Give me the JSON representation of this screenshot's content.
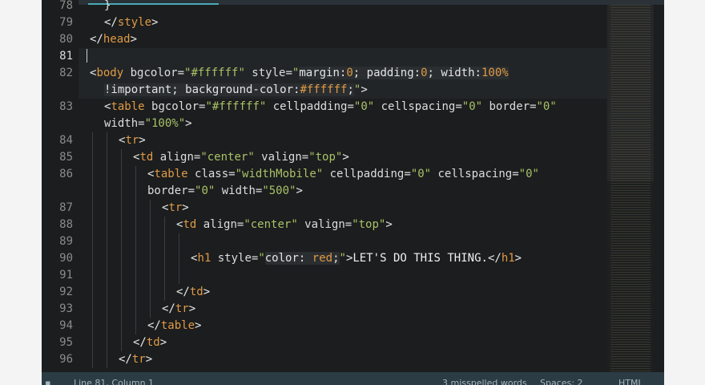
{
  "editor": {
    "lines": [
      {
        "n": "78",
        "segments": [
          {
            "c": "pl",
            "t": "}"
          }
        ]
      },
      {
        "n": "79",
        "segments": [
          {
            "c": "tk",
            "t": "</"
          },
          {
            "c": "tag",
            "t": "style"
          },
          {
            "c": "tk",
            "t": ">"
          }
        ]
      },
      {
        "n": "80",
        "segments": [
          {
            "c": "tk",
            "t": "</"
          },
          {
            "c": "tag",
            "t": "head"
          },
          {
            "c": "tk",
            "t": ">"
          }
        ]
      },
      {
        "n": "81",
        "segments": []
      },
      {
        "n": "82",
        "segments": [
          {
            "c": "tk",
            "t": "<"
          },
          {
            "c": "tag",
            "t": "body"
          },
          {
            "c": "attr",
            "t": " bgcolor="
          },
          {
            "c": "str",
            "t": "\"#ffffff\""
          },
          {
            "c": "attr",
            "t": " style="
          },
          {
            "c": "str",
            "t": "\""
          },
          {
            "c": "pl inl",
            "t": "margin"
          },
          {
            "c": "tk inl",
            "t": ":"
          },
          {
            "c": "num inl",
            "t": "0"
          },
          {
            "c": "pl inl",
            "t": "; padding"
          },
          {
            "c": "tk inl",
            "t": ":"
          },
          {
            "c": "num inl",
            "t": "0"
          },
          {
            "c": "pl inl",
            "t": "; width"
          },
          {
            "c": "tk inl",
            "t": ":"
          },
          {
            "c": "num inl",
            "t": "100%"
          }
        ]
      },
      {
        "n": "",
        "segments": [
          {
            "c": "pl inl",
            "t": "!important; background-color"
          },
          {
            "c": "tk inl",
            "t": ":"
          },
          {
            "c": "num inl",
            "t": "#ffffff"
          },
          {
            "c": "pl inl",
            "t": ";"
          },
          {
            "c": "str",
            "t": "\""
          },
          {
            "c": "tk",
            "t": ">"
          }
        ]
      },
      {
        "n": "83",
        "segments": [
          {
            "c": "tk",
            "t": "<"
          },
          {
            "c": "tag",
            "t": "table"
          },
          {
            "c": "attr",
            "t": " bgcolor="
          },
          {
            "c": "str",
            "t": "\"#ffffff\""
          },
          {
            "c": "attr",
            "t": " cellpadding="
          },
          {
            "c": "str",
            "t": "\"0\""
          },
          {
            "c": "attr",
            "t": " cellspacing="
          },
          {
            "c": "str",
            "t": "\"0\""
          },
          {
            "c": "attr",
            "t": " border="
          },
          {
            "c": "str",
            "t": "\"0\""
          }
        ]
      },
      {
        "n": "",
        "segments": [
          {
            "c": "attr",
            "t": "width="
          },
          {
            "c": "str",
            "t": "\"100%\""
          },
          {
            "c": "tk",
            "t": ">"
          }
        ]
      },
      {
        "n": "84",
        "segments": [
          {
            "c": "tk",
            "t": "<"
          },
          {
            "c": "tag",
            "t": "tr"
          },
          {
            "c": "tk",
            "t": ">"
          }
        ]
      },
      {
        "n": "85",
        "segments": [
          {
            "c": "tk",
            "t": "<"
          },
          {
            "c": "tag",
            "t": "td"
          },
          {
            "c": "attr",
            "t": " align="
          },
          {
            "c": "str",
            "t": "\"center\""
          },
          {
            "c": "attr",
            "t": " valign="
          },
          {
            "c": "str",
            "t": "\"top\""
          },
          {
            "c": "tk",
            "t": ">"
          }
        ]
      },
      {
        "n": "86",
        "segments": [
          {
            "c": "tk",
            "t": "<"
          },
          {
            "c": "tag",
            "t": "table"
          },
          {
            "c": "attr",
            "t": " class="
          },
          {
            "c": "str",
            "t": "\"widthMobile\""
          },
          {
            "c": "attr",
            "t": " cellpadding="
          },
          {
            "c": "str",
            "t": "\"0\""
          },
          {
            "c": "attr",
            "t": " cellspacing="
          },
          {
            "c": "str",
            "t": "\"0\""
          }
        ]
      },
      {
        "n": "",
        "segments": [
          {
            "c": "attr",
            "t": "border="
          },
          {
            "c": "str",
            "t": "\"0\""
          },
          {
            "c": "attr",
            "t": " width="
          },
          {
            "c": "str",
            "t": "\"500\""
          },
          {
            "c": "tk",
            "t": ">"
          }
        ]
      },
      {
        "n": "87",
        "segments": [
          {
            "c": "tk",
            "t": "<"
          },
          {
            "c": "tag",
            "t": "tr"
          },
          {
            "c": "tk",
            "t": ">"
          }
        ]
      },
      {
        "n": "88",
        "segments": [
          {
            "c": "tk",
            "t": "<"
          },
          {
            "c": "tag",
            "t": "td"
          },
          {
            "c": "attr",
            "t": " align="
          },
          {
            "c": "str",
            "t": "\"center\""
          },
          {
            "c": "attr",
            "t": " valign="
          },
          {
            "c": "str",
            "t": "\"top\""
          },
          {
            "c": "tk",
            "t": ">"
          }
        ]
      },
      {
        "n": "89",
        "segments": []
      },
      {
        "n": "90",
        "segments": [
          {
            "c": "tk",
            "t": "<"
          },
          {
            "c": "tag",
            "t": "h1"
          },
          {
            "c": "attr",
            "t": " style="
          },
          {
            "c": "str",
            "t": "\""
          },
          {
            "c": "pl inl",
            "t": "color"
          },
          {
            "c": "tk inl",
            "t": ": "
          },
          {
            "c": "num inl",
            "t": "red"
          },
          {
            "c": "pl inl",
            "t": ";"
          },
          {
            "c": "str",
            "t": "\""
          },
          {
            "c": "tk",
            "t": ">"
          },
          {
            "c": "txt",
            "t": "LET'S DO THIS THING."
          },
          {
            "c": "tk",
            "t": "</"
          },
          {
            "c": "tag",
            "t": "h1"
          },
          {
            "c": "tk",
            "t": ">"
          }
        ]
      },
      {
        "n": "91",
        "segments": []
      },
      {
        "n": "92",
        "segments": [
          {
            "c": "tk",
            "t": "</"
          },
          {
            "c": "tag",
            "t": "td"
          },
          {
            "c": "tk",
            "t": ">"
          }
        ]
      },
      {
        "n": "93",
        "segments": [
          {
            "c": "tk",
            "t": "</"
          },
          {
            "c": "tag",
            "t": "tr"
          },
          {
            "c": "tk",
            "t": ">"
          }
        ]
      },
      {
        "n": "94",
        "segments": [
          {
            "c": "tk",
            "t": "</"
          },
          {
            "c": "tag",
            "t": "table"
          },
          {
            "c": "tk",
            "t": ">"
          }
        ]
      },
      {
        "n": "95",
        "segments": [
          {
            "c": "tk",
            "t": "</"
          },
          {
            "c": "tag",
            "t": "td"
          },
          {
            "c": "tk",
            "t": ">"
          }
        ]
      },
      {
        "n": "96",
        "segments": [
          {
            "c": "tk",
            "t": "</"
          },
          {
            "c": "tag",
            "t": "tr"
          },
          {
            "c": "tk",
            "t": ">"
          }
        ]
      }
    ]
  },
  "statusbar": {
    "position": "Line 81, Column 1",
    "spelling": "3 misspelled words",
    "indent": "Spaces: 2",
    "syntax": "HTML"
  },
  "colors": {
    "background": "#1b1d1e",
    "tag": "#e09a45",
    "string": "#a8c267",
    "statusbar": "#2c3c45"
  }
}
